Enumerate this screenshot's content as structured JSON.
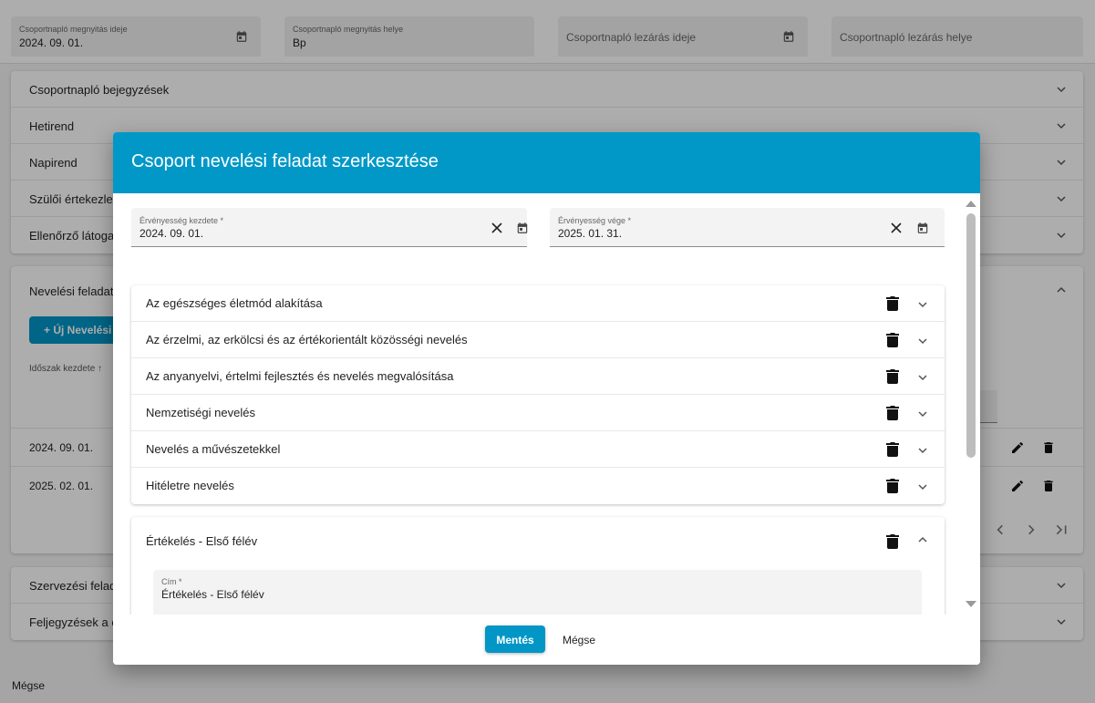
{
  "top_fields": {
    "open_date_label": "Csoportnapló megnyitás ideje",
    "open_date_value": "2024. 09. 01.",
    "open_place_label": "Csoportnapló megnyitás helye",
    "open_place_value": "Bp",
    "close_date_placeholder": "Csoportnapló lezárás ideje",
    "close_place_placeholder": "Csoportnapló lezárás helye"
  },
  "sections": [
    "Csoportnapló bejegyzések",
    "Hetirend",
    "Napirend",
    "Szülői értekezlet",
    "Ellenőrző látogat"
  ],
  "nevelesi": {
    "title": "Nevelési feladato",
    "new_button": "+ Új Nevelési",
    "sort_header": "Időszak kezdete ↑",
    "rows": [
      "2024. 09. 01.",
      "2025. 02. 01."
    ]
  },
  "bottom_sections": [
    "Szervezési felada",
    "Feljegyzések a c"
  ],
  "page_cancel": "Mégse",
  "dialog": {
    "title": "Csoport nevelési feladat szerkesztése",
    "start_label": "Érvényesség kezdete *",
    "start_value": "2024. 09. 01.",
    "end_label": "Érvényesség vége *",
    "end_value": "2025. 01. 31.",
    "tasks": [
      "Az egészséges életmód alakítása",
      "Az érzelmi, az erkölcsi és az értékorientált közösségi nevelés",
      "Az anyanyelvi, értelmi fejlesztés és nevelés megvalósítása",
      "Nemzetiségi nevelés",
      "Nevelés a művészetekkel",
      "Hitéletre nevelés"
    ],
    "evaluation": {
      "title": "Értékelés - Első félév",
      "cim_label": "Cím *",
      "cim_value": "Értékelés - Első félév"
    },
    "save_label": "Mentés",
    "cancel_label": "Mégse"
  },
  "colors": {
    "accent": "#0198c8"
  }
}
